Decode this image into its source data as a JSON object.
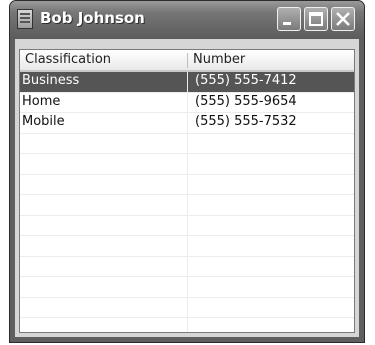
{
  "window": {
    "title": "Bob Johnson",
    "controls": {
      "minimize_icon": "minimize-icon",
      "maximize_icon": "maximize-icon",
      "close_icon": "close-icon"
    }
  },
  "list": {
    "columns": [
      "Classification",
      "Number"
    ],
    "rows": [
      {
        "classification": "Business",
        "number": "(555) 555-7412",
        "selected": true
      },
      {
        "classification": "Home",
        "number": "(555) 555-9654",
        "selected": false
      },
      {
        "classification": "Mobile",
        "number": "(555) 555-7532",
        "selected": false
      }
    ]
  }
}
